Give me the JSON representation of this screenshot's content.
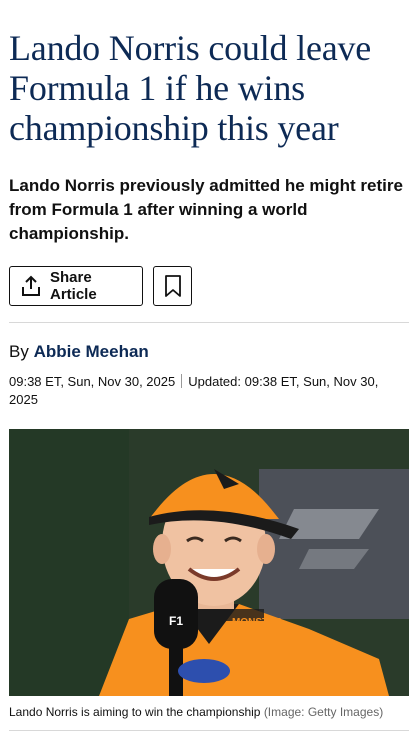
{
  "article": {
    "headline": "Lando Norris could leave Formula 1 if he wins championship this year",
    "standfirst": "Lando Norris previously admitted he might retire from Formula 1 after winning a world championship.",
    "share_label": "Share Article",
    "byline_prefix": "By",
    "author": "Abbie Meehan",
    "published": "09:38 ET, Sun, Nov 30, 2025",
    "updated": "Updated: 09:38 ET, Sun, Nov 30, 2025",
    "image_caption": "Lando Norris is aiming to win the championship",
    "image_credit": "(Image: Getty Images)",
    "image_text": {
      "brand": "MONSTER",
      "cap_logo": "F1"
    }
  },
  "icons": {
    "share": "share-icon",
    "bookmark": "bookmark-icon"
  },
  "colors": {
    "headline": "#0d2a55",
    "author": "#0d2a55",
    "papaya": "#f7901e"
  }
}
